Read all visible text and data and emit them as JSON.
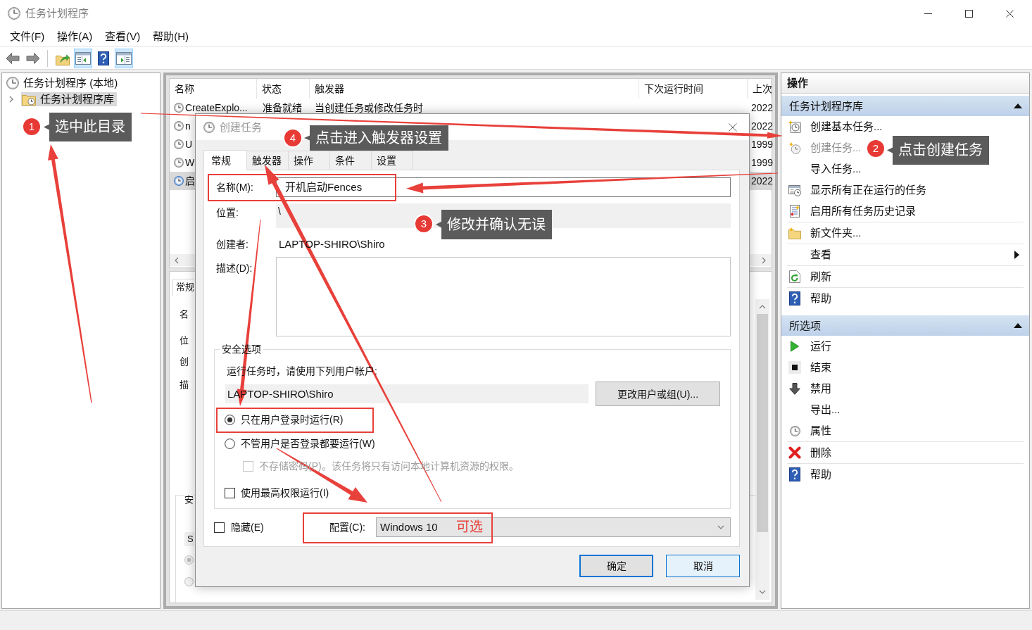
{
  "window": {
    "title": "任务计划程序"
  },
  "menu": [
    "文件(F)",
    "操作(A)",
    "查看(V)",
    "帮助(H)"
  ],
  "toolbar": {
    "groups": [
      [
        {
          "kind": "back",
          "pressed": false
        },
        {
          "kind": "forward",
          "pressed": false
        }
      ],
      [
        {
          "kind": "up",
          "pressed": false
        },
        {
          "kind": "tree",
          "pressed": true
        },
        {
          "kind": "help",
          "pressed": false
        },
        {
          "kind": "actions",
          "pressed": true
        }
      ]
    ]
  },
  "tree": [
    {
      "label": "任务计划程序 (本地)",
      "selected": false,
      "children": [
        {
          "label": "任务计划程序库",
          "selected": true,
          "expanded": false
        }
      ]
    }
  ],
  "task_list": {
    "columns": [
      "名称",
      "状态",
      "触发器",
      "下次运行时间",
      "上次"
    ],
    "rows": [
      {
        "name": "CreateExplo...",
        "status": "准备就绪",
        "trigger": "当创建任务或修改任务时",
        "column_5": "2022",
        "selected": false
      },
      {
        "name": "n",
        "column_5": "2022",
        "selected": false
      },
      {
        "name": "U",
        "column_5": "1999",
        "selected": false
      },
      {
        "name": "W",
        "column_5": "1999",
        "selected": false
      },
      {
        "name": "启",
        "column_5": "2022",
        "selected": true
      }
    ]
  },
  "task_details": {
    "tabs": [
      {
        "label": "常规",
        "selected": true
      }
    ],
    "labels": [
      "名",
      "位",
      "创",
      "描"
    ],
    "group_label": "安",
    "account": "S",
    "options": [
      {
        "checked": true
      },
      {
        "checked": false
      }
    ]
  },
  "dialog": {
    "title": "创建任务",
    "tabs": [
      {
        "label": "常规",
        "selected": true
      },
      {
        "label": "触发器",
        "selected": false
      },
      {
        "label": "操作",
        "selected": false
      },
      {
        "label": "条件",
        "selected": false
      },
      {
        "label": "设置",
        "selected": false
      }
    ],
    "name": {
      "label": "名称(M):",
      "value": "开机启动Fences"
    },
    "location": {
      "label": "位置:",
      "value": "\\"
    },
    "author": {
      "label": "创建者:",
      "value": "LAPTOP-SHIRO\\Shiro"
    },
    "description": {
      "label": "描述(D):"
    },
    "security": {
      "title": "安全选项",
      "prompt": "运行任务时，请使用下列用户帐户:",
      "account": "LAPTOP-SHIRO\\Shiro",
      "change_button": "更改用户或组(U)...",
      "options": [
        {
          "kind": "radio",
          "label": "只在用户登录时运行(R)",
          "checked": true,
          "disabled": false
        },
        {
          "kind": "radio",
          "label": "不管用户是否登录都要运行(W)",
          "checked": false,
          "disabled": false,
          "children": [
            {
              "kind": "checkbox",
              "label": "不存储密码(P)。该任务将只有访问本地计算机资源的权限。",
              "checked": false,
              "disabled": true
            }
          ]
        },
        {
          "kind": "checkbox",
          "label": "使用最高权限运行(I)",
          "checked": false,
          "disabled": false
        }
      ]
    },
    "hidden": {
      "label": "隐藏(E)",
      "checked": false
    },
    "configure": {
      "label": "配置(C):",
      "value": "Windows 10"
    },
    "buttons": [
      {
        "label": "确定",
        "default": true,
        "hover": false
      },
      {
        "label": "取消",
        "default": false,
        "hover": true
      }
    ]
  },
  "actions_pane": {
    "title": "操作",
    "sections": [
      {
        "title": "任务计划程序库",
        "expanded": true,
        "groups": [
          [
            {
              "label": "创建基本任务...",
              "kind": "basic",
              "disabled": false
            },
            {
              "label": "创建任务...",
              "kind": "create",
              "disabled": true
            },
            {
              "label": "导入任务...",
              "kind": "plain",
              "disabled": false
            },
            {
              "label": "显示所有正在运行的任务",
              "kind": "running",
              "disabled": false
            },
            {
              "label": "启用所有任务历史记录",
              "kind": "history",
              "disabled": false
            }
          ],
          [
            {
              "label": "新文件夹...",
              "kind": "folder",
              "disabled": false
            }
          ],
          [
            {
              "label": "查看",
              "kind": "submenu",
              "disabled": false
            }
          ],
          [
            {
              "label": "刷新",
              "kind": "refresh",
              "disabled": false
            }
          ],
          [
            {
              "label": "帮助",
              "kind": "help",
              "disabled": false
            }
          ]
        ]
      },
      {
        "title": "所选项",
        "expanded": true,
        "groups": [
          [
            {
              "label": "运行",
              "kind": "run",
              "disabled": false
            },
            {
              "label": "结束",
              "kind": "stop",
              "disabled": false
            },
            {
              "label": "禁用",
              "kind": "disable",
              "disabled": false
            },
            {
              "label": "导出...",
              "kind": "plain",
              "disabled": false
            },
            {
              "label": "属性",
              "kind": "properties",
              "disabled": false
            }
          ],
          [
            {
              "label": "删除",
              "kind": "delete",
              "disabled": false
            }
          ],
          [
            {
              "label": "帮助",
              "kind": "help",
              "disabled": false
            }
          ]
        ]
      }
    ]
  },
  "annotations": {
    "callouts": [
      {
        "number": "1",
        "text": "选中此目录"
      },
      {
        "number": "2",
        "text": "点击创建任务"
      },
      {
        "number": "3",
        "text": "修改并确认无误"
      },
      {
        "number": "4",
        "text": "点击进入触发器设置"
      }
    ],
    "notes": [
      "可选"
    ]
  }
}
